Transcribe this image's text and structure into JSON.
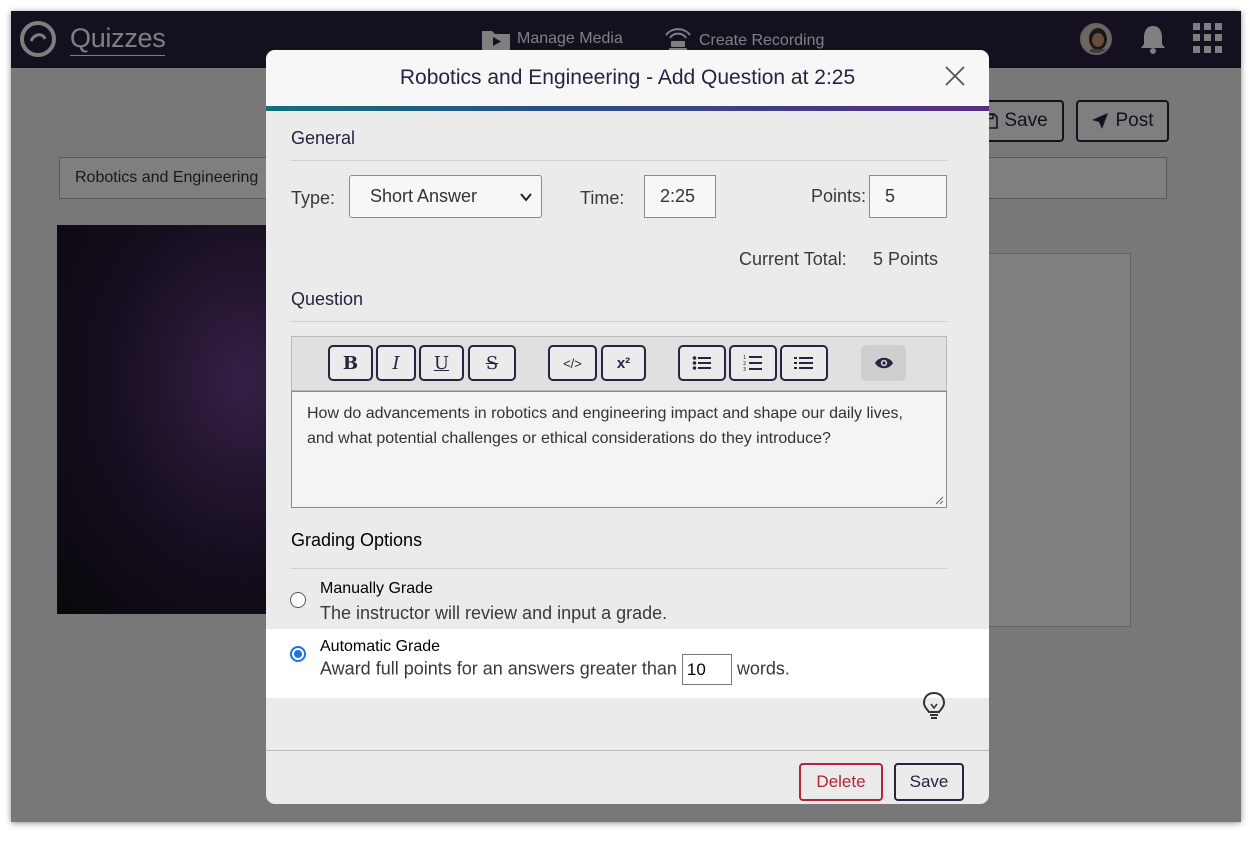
{
  "app": {
    "brand": "Quizzes",
    "nav": {
      "manage_media": "Manage Media",
      "create_recording": "Create Recording"
    }
  },
  "page": {
    "save_label": "Save",
    "post_label": "Post",
    "title_value": "Robotics and Engineering"
  },
  "modal": {
    "title": "Robotics and Engineering - Add Question at 2:25",
    "general": {
      "heading": "General",
      "type_label": "Type:",
      "type_value": "Short Answer",
      "time_label": "Time:",
      "time_value": "2:25",
      "points_label": "Points:",
      "points_value": "5",
      "current_total_label": "Current Total:",
      "current_total_value": "5 Points"
    },
    "question": {
      "heading": "Question",
      "toolbar": [
        "B",
        "I",
        "U",
        "S",
        "</>",
        "x²"
      ],
      "text": "How do advancements in robotics and engineering impact and shape our daily lives, and what potential challenges or ethical considerations do they introduce?"
    },
    "grading": {
      "heading": "Grading Options",
      "manual_title": "Manually Grade",
      "manual_desc": "The instructor will review and input a grade.",
      "auto_title": "Automatic Grade",
      "auto_desc_prefix": "Award full points for an answers greater than",
      "auto_words_value": "10",
      "auto_desc_suffix": "words.",
      "selected": "automatic"
    },
    "footer": {
      "delete_label": "Delete",
      "save_label": "Save"
    }
  },
  "colors": {
    "brand_dark": "#2b2140",
    "danger": "#b3243a",
    "radio_selected": "#1a73e8"
  },
  "icons": [
    "quizzes-logo-icon",
    "video-folder-icon",
    "recording-icon",
    "bell-icon",
    "apps-grid-icon",
    "close-icon",
    "eye-icon",
    "lightbulb-icon",
    "floppy-disk-icon",
    "paper-plane-icon"
  ]
}
